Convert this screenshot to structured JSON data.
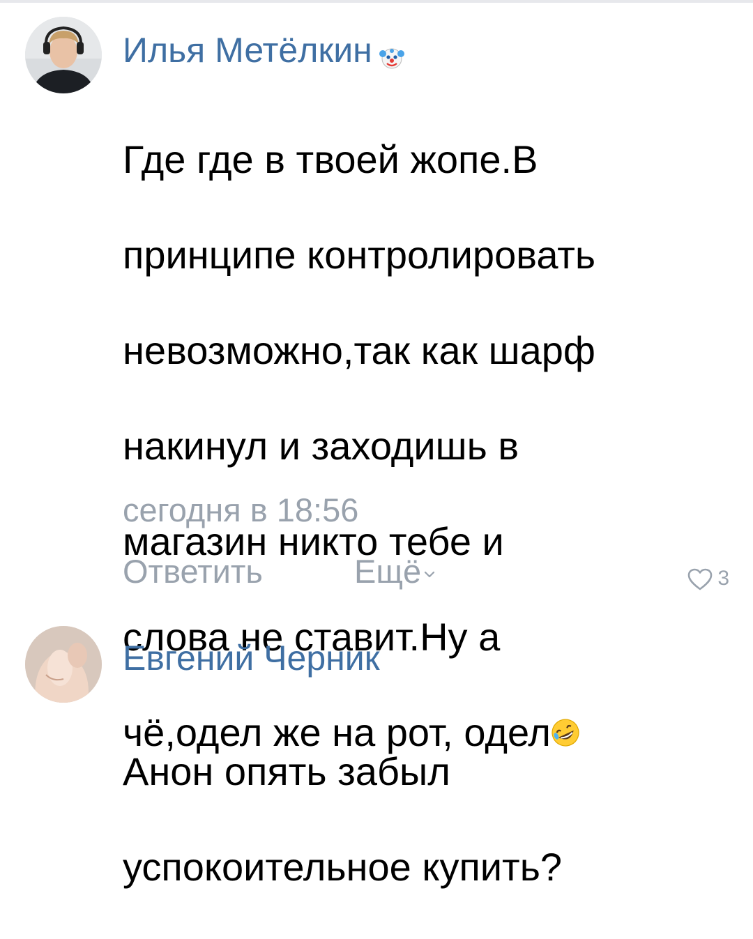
{
  "comments": [
    {
      "author": "Илья Метёлкин",
      "badge_icon": "clown-face-emoji-icon",
      "lines": [
        "Где где в твоей жопе.В",
        "принципе контролировать",
        "невозможно,так как шарф",
        "накинул и заходишь в",
        "магазин никто тебе и",
        "слова не ставит.Ну а",
        "чё,одел же на рот, одел"
      ],
      "trailing_emoji": "rolling-on-floor-laughing-emoji-icon",
      "timestamp": "сегодня в 18:56",
      "reply_label": "Ответить",
      "more_label": "Ещё",
      "likes": "3"
    },
    {
      "author": "Евгений Черник",
      "lines": [
        "Анон опять забыл",
        "успокоительное купить?"
      ]
    }
  ],
  "colors": {
    "author": "#3f6fa3",
    "secondary_text": "#99a2ad",
    "divider": "#e7e8ec"
  }
}
